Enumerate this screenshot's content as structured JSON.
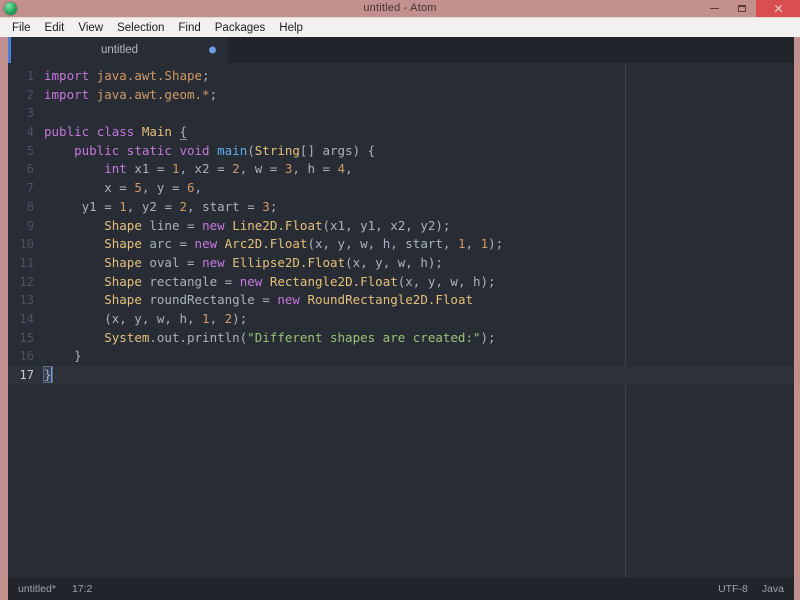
{
  "window": {
    "title": "untitled - Atom",
    "logo_icon": "atom-logo-icon",
    "controls": {
      "minimize_label": "minimize-icon",
      "maximize_label": "maximize-icon",
      "close_label": "close-icon"
    }
  },
  "menubar": {
    "items": [
      {
        "label": "File"
      },
      {
        "label": "Edit"
      },
      {
        "label": "View"
      },
      {
        "label": "Selection"
      },
      {
        "label": "Find"
      },
      {
        "label": "Packages"
      },
      {
        "label": "Help"
      }
    ]
  },
  "tabs": [
    {
      "label": "untitled",
      "modified": true
    }
  ],
  "editor": {
    "language": "Java",
    "cursor": {
      "line": 17,
      "column": 2
    },
    "lines": [
      {
        "n": "1",
        "tokens": [
          {
            "t": "import",
            "c": "kw"
          },
          {
            "t": " ",
            "c": "plain"
          },
          {
            "t": "java.awt.Shape",
            "c": "pkg"
          },
          {
            "t": ";",
            "c": "punc"
          }
        ]
      },
      {
        "n": "2",
        "tokens": [
          {
            "t": "import",
            "c": "kw"
          },
          {
            "t": " ",
            "c": "plain"
          },
          {
            "t": "java.awt.geom.*",
            "c": "pkg"
          },
          {
            "t": ";",
            "c": "punc"
          }
        ]
      },
      {
        "n": "3",
        "tokens": []
      },
      {
        "n": "4",
        "tokens": [
          {
            "t": "public",
            "c": "kw"
          },
          {
            "t": " ",
            "c": "plain"
          },
          {
            "t": "class",
            "c": "kw"
          },
          {
            "t": " ",
            "c": "plain"
          },
          {
            "t": "Main",
            "c": "type"
          },
          {
            "t": " ",
            "c": "plain"
          },
          {
            "t": "{",
            "c": "punc bracket-match"
          }
        ]
      },
      {
        "n": "5",
        "tokens": [
          {
            "t": "    ",
            "c": "plain"
          },
          {
            "t": "public",
            "c": "kw"
          },
          {
            "t": " ",
            "c": "plain"
          },
          {
            "t": "static",
            "c": "kw"
          },
          {
            "t": " ",
            "c": "plain"
          },
          {
            "t": "void",
            "c": "kw"
          },
          {
            "t": " ",
            "c": "plain"
          },
          {
            "t": "main",
            "c": "fn"
          },
          {
            "t": "(",
            "c": "punc"
          },
          {
            "t": "String",
            "c": "type"
          },
          {
            "t": "[] args) {",
            "c": "plain"
          }
        ]
      },
      {
        "n": "6",
        "tokens": [
          {
            "t": "        ",
            "c": "plain"
          },
          {
            "t": "int",
            "c": "kw"
          },
          {
            "t": " x1 = ",
            "c": "plain"
          },
          {
            "t": "1",
            "c": "num"
          },
          {
            "t": ", x2 = ",
            "c": "plain"
          },
          {
            "t": "2",
            "c": "num"
          },
          {
            "t": ", w = ",
            "c": "plain"
          },
          {
            "t": "3",
            "c": "num"
          },
          {
            "t": ", h = ",
            "c": "plain"
          },
          {
            "t": "4",
            "c": "num"
          },
          {
            "t": ",",
            "c": "plain"
          }
        ]
      },
      {
        "n": "7",
        "tokens": [
          {
            "t": "        x = ",
            "c": "plain"
          },
          {
            "t": "5",
            "c": "num"
          },
          {
            "t": ", y = ",
            "c": "plain"
          },
          {
            "t": "6",
            "c": "num"
          },
          {
            "t": ",",
            "c": "plain"
          }
        ]
      },
      {
        "n": "8",
        "tokens": [
          {
            "t": "     y1 = ",
            "c": "plain"
          },
          {
            "t": "1",
            "c": "num"
          },
          {
            "t": ", y2 = ",
            "c": "plain"
          },
          {
            "t": "2",
            "c": "num"
          },
          {
            "t": ", start = ",
            "c": "plain"
          },
          {
            "t": "3",
            "c": "num"
          },
          {
            "t": ";",
            "c": "plain"
          }
        ]
      },
      {
        "n": "9",
        "tokens": [
          {
            "t": "        ",
            "c": "plain"
          },
          {
            "t": "Shape",
            "c": "type"
          },
          {
            "t": " line = ",
            "c": "plain"
          },
          {
            "t": "new",
            "c": "kw"
          },
          {
            "t": " ",
            "c": "plain"
          },
          {
            "t": "Line2D.Float",
            "c": "type"
          },
          {
            "t": "(x1, y1, x2, y2);",
            "c": "plain"
          }
        ]
      },
      {
        "n": "10",
        "tokens": [
          {
            "t": "        ",
            "c": "plain"
          },
          {
            "t": "Shape",
            "c": "type"
          },
          {
            "t": " arc = ",
            "c": "plain"
          },
          {
            "t": "new",
            "c": "kw"
          },
          {
            "t": " ",
            "c": "plain"
          },
          {
            "t": "Arc2D.Float",
            "c": "type"
          },
          {
            "t": "(x, y, w, h, start, ",
            "c": "plain"
          },
          {
            "t": "1",
            "c": "num"
          },
          {
            "t": ", ",
            "c": "plain"
          },
          {
            "t": "1",
            "c": "num"
          },
          {
            "t": ");",
            "c": "plain"
          }
        ]
      },
      {
        "n": "11",
        "tokens": [
          {
            "t": "        ",
            "c": "plain"
          },
          {
            "t": "Shape",
            "c": "type"
          },
          {
            "t": " oval = ",
            "c": "plain"
          },
          {
            "t": "new",
            "c": "kw"
          },
          {
            "t": " ",
            "c": "plain"
          },
          {
            "t": "Ellipse2D.Float",
            "c": "type"
          },
          {
            "t": "(x, y, w, h);",
            "c": "plain"
          }
        ]
      },
      {
        "n": "12",
        "tokens": [
          {
            "t": "        ",
            "c": "plain"
          },
          {
            "t": "Shape",
            "c": "type"
          },
          {
            "t": " rectangle = ",
            "c": "plain"
          },
          {
            "t": "new",
            "c": "kw"
          },
          {
            "t": " ",
            "c": "plain"
          },
          {
            "t": "Rectangle2D.Float",
            "c": "type"
          },
          {
            "t": "(x, y, w, h);",
            "c": "plain"
          }
        ]
      },
      {
        "n": "13",
        "tokens": [
          {
            "t": "        ",
            "c": "plain"
          },
          {
            "t": "Shape",
            "c": "type"
          },
          {
            "t": " roundRectangle = ",
            "c": "plain"
          },
          {
            "t": "new",
            "c": "kw"
          },
          {
            "t": " ",
            "c": "plain"
          },
          {
            "t": "RoundRectangle2D.Float",
            "c": "type"
          }
        ]
      },
      {
        "n": "14",
        "tokens": [
          {
            "t": "        (x, y, w, h, ",
            "c": "plain"
          },
          {
            "t": "1",
            "c": "num"
          },
          {
            "t": ", ",
            "c": "plain"
          },
          {
            "t": "2",
            "c": "num"
          },
          {
            "t": ");",
            "c": "plain"
          }
        ]
      },
      {
        "n": "15",
        "tokens": [
          {
            "t": "        ",
            "c": "plain"
          },
          {
            "t": "System",
            "c": "type"
          },
          {
            "t": ".out.println(",
            "c": "plain"
          },
          {
            "t": "\"Different shapes are created:\"",
            "c": "str"
          },
          {
            "t": ");",
            "c": "plain"
          }
        ]
      },
      {
        "n": "16",
        "tokens": [
          {
            "t": "    }",
            "c": "plain"
          }
        ]
      },
      {
        "n": "17",
        "tokens": [
          {
            "t": "}",
            "c": "punc bracket-box"
          }
        ],
        "active": true,
        "cursor": true
      }
    ]
  },
  "statusbar": {
    "file_label": "untitled*",
    "position_label": "17:2",
    "encoding_label": "UTF-8",
    "grammar_label": "Java"
  },
  "colors": {
    "titlebar_bg": "#c2908f",
    "menubar_bg": "#f2f1ef",
    "editor_bg": "#282c34",
    "tabbar_bg": "#21252b",
    "statusbar_bg": "#21252b",
    "accent_blue": "#4a7fd4",
    "close_red": "#d94f4f",
    "keyword": "#c678dd",
    "type": "#e5c07b",
    "function": "#61afef",
    "string": "#98c379",
    "number": "#d19a66"
  }
}
